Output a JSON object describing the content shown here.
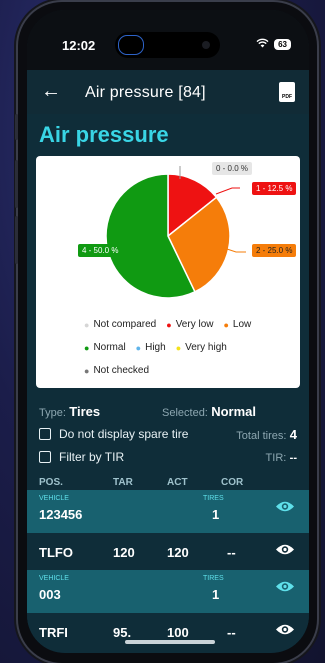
{
  "status": {
    "time": "12:02",
    "battery": "63"
  },
  "appbar": {
    "title": "Air pressure [84]"
  },
  "page_title": "Air pressure",
  "chart_data": {
    "type": "pie",
    "slices": [
      {
        "label": "0 - 0.0 %",
        "value": 0.0,
        "color": "#e6e6e6"
      },
      {
        "label": "1 - 12.5 %",
        "value": 12.5,
        "color": "#ee1212"
      },
      {
        "label": "2 - 25.0 %",
        "value": 25.0,
        "color": "#f57d0a"
      },
      {
        "label": "4 - 50.0 %",
        "value": 50.0,
        "color": "#109a12"
      }
    ],
    "legend": [
      {
        "label": "Not compared",
        "color": "#d6d6d6"
      },
      {
        "label": "Very low",
        "color": "#ee1212"
      },
      {
        "label": "Low",
        "color": "#f57d0a"
      },
      {
        "label": "Normal",
        "color": "#109a12"
      },
      {
        "label": "High",
        "color": "#5fb4ea"
      },
      {
        "label": "Very high",
        "color": "#f4e21a"
      },
      {
        "label": "Not checked",
        "color": "#777777"
      }
    ]
  },
  "info": {
    "type_label": "Type:",
    "type_value": "Tires",
    "selected_label": "Selected:",
    "selected_value": "Normal",
    "spare_label": "Do not display spare tire",
    "total_label": "Total tires:",
    "total_value": "4",
    "filter_label": "Filter by TIR",
    "tir_label": "TIR:",
    "tir_value": "--"
  },
  "table": {
    "headers": [
      "POS.",
      "TAR",
      "ACT",
      "COR"
    ],
    "vehicle_label": "VEHICLE",
    "tires_label": "TIRES",
    "groups": [
      {
        "vehicle": "123456",
        "tires": "1",
        "row": {
          "pos": "TLFO",
          "tar": "120",
          "act": "120",
          "cor": "--"
        }
      },
      {
        "vehicle": "003",
        "tires": "1",
        "row": {
          "pos": "TRFI",
          "tar": "95.",
          "act": "100",
          "cor": "--"
        }
      }
    ]
  }
}
